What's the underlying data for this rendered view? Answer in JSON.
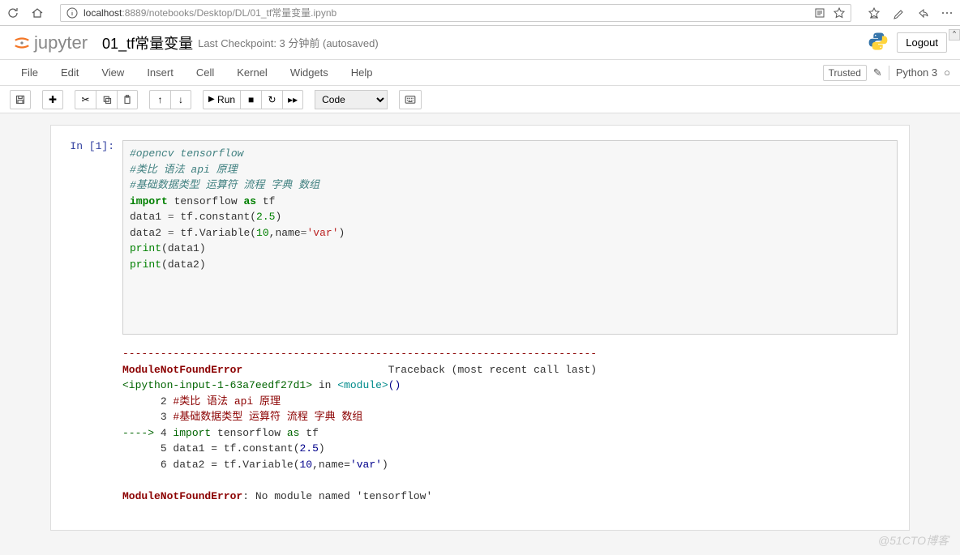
{
  "browser": {
    "url_prefix": "localhost",
    "url_rest": ":8889/notebooks/Desktop/DL/01_tf常量变量.ipynb"
  },
  "header": {
    "logo_text": "jupyter",
    "notebook_title": "01_tf常量变量",
    "checkpoint": "Last Checkpoint: 3 分钟前  (autosaved)",
    "logout": "Logout"
  },
  "menu": {
    "file": "File",
    "edit": "Edit",
    "view": "View",
    "insert": "Insert",
    "cell": "Cell",
    "kernel": "Kernel",
    "widgets": "Widgets",
    "help": "Help",
    "trusted": "Trusted",
    "kernel_name": "Python 3"
  },
  "toolbar": {
    "run": "Run",
    "cell_type": "Code"
  },
  "cell": {
    "prompt": "In [1]:",
    "code": {
      "c1": "#opencv tensorflow",
      "c2": "#类比 语法 api 原理",
      "c3": "#基础数据类型 运算符 流程 字典 数组",
      "kw_import": "import",
      "mod": " tensorflow ",
      "kw_as": "as",
      "alias": " tf",
      "l5a": "data1 ",
      "eq": "=",
      "l5b": " tf.constant(",
      "num1": "2.5",
      "l5c": ")",
      "l6a": "data2 ",
      "l6b": " tf.Variable(",
      "num2": "10",
      "l6c": ",name",
      "l6d": "=",
      "str1": "'var'",
      "l6e": ")",
      "l7": "print",
      "l7a": "(data1)",
      "l8": "print",
      "l8a": "(data2)"
    }
  },
  "output": {
    "hr": "---------------------------------------------------------------------------",
    "err": "ModuleNotFoundError",
    "tb": "                       Traceback (most recent call last)",
    "ip_open": "<ipython-input-1-63a7eedf27d1>",
    "ip_in": " in ",
    "mod_open": "<module>",
    "paren": "()",
    "l2n": "      2 ",
    "l2": "#类比 语法 api 原理",
    "l3n": "      3 ",
    "l3": "#基础数据类型 运算符 流程 字典 数组",
    "arrow": "----> ",
    "l4n": "4 ",
    "l4a": "import",
    "l4b": " tensorflow ",
    "l4c": "as",
    "l4d": " tf",
    "l5n": "      5 ",
    "l5a": "data1 ",
    "l5eq": "=",
    "l5b": " tf",
    "l5dot": ".",
    "l5c": "constant",
    "l5p1": "(",
    "l5num": "2.5",
    "l5p2": ")",
    "l6n": "      6 ",
    "l6a": "data2 ",
    "l6eq": "=",
    "l6b": " tf",
    "l6dot": ".",
    "l6c": "Variable",
    "l6p1": "(",
    "l6num": "10",
    "l6com": ",",
    "l6name": "name",
    "l6eq2": "=",
    "l6str": "'var'",
    "l6p2": ")",
    "final_err": "ModuleNotFoundError",
    "final_msg": ": No module named 'tensorflow'"
  },
  "watermark": "@51CTO博客"
}
